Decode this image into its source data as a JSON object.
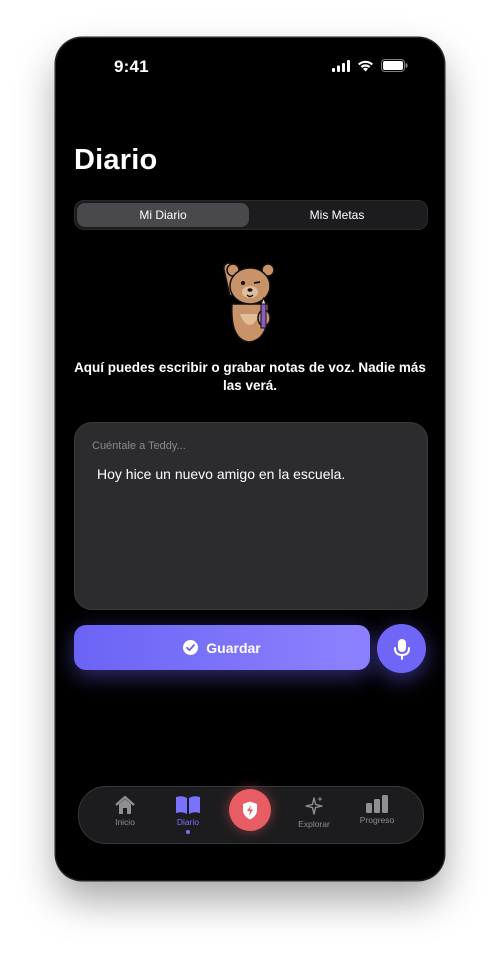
{
  "status": {
    "time": "9:41"
  },
  "page": {
    "title": "Diario"
  },
  "segments": {
    "active": "Mi Diario",
    "inactive": "Mis Metas"
  },
  "intro": "Aquí puedes escribir o grabar notas de voz. Nadie más las verá.",
  "note": {
    "placeholder": "Cuéntale a Teddy...",
    "text": "Hoy hice un nuevo amigo en la escuela."
  },
  "actions": {
    "save_label": "Guardar"
  },
  "tabs": [
    {
      "label": "Inicio",
      "icon": "home-icon"
    },
    {
      "label": "Diario",
      "icon": "book-icon"
    },
    {
      "label": "",
      "icon": "shield-bolt-icon"
    },
    {
      "label": "Explorar",
      "icon": "sparkles-icon"
    },
    {
      "label": "Progreso",
      "icon": "bar-chart-icon"
    }
  ],
  "colors": {
    "accent": "#6f66f7",
    "center_action": "#e85c63",
    "background": "#000000",
    "card": "#2c2c2e"
  }
}
